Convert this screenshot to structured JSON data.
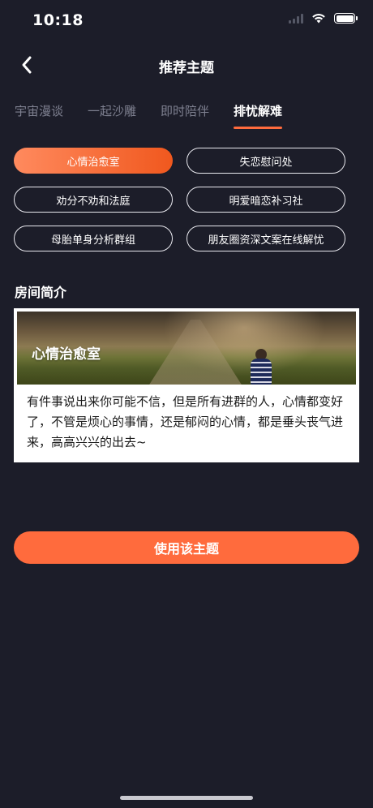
{
  "status_bar": {
    "time": "10:18"
  },
  "nav": {
    "title": "推荐主题",
    "back_icon": "chevron-left-icon"
  },
  "tabs": [
    {
      "label": "宇宙漫谈",
      "active": false
    },
    {
      "label": "一起沙雕",
      "active": false
    },
    {
      "label": "即时陪伴",
      "active": false
    },
    {
      "label": "排忧解难",
      "active": true
    }
  ],
  "topics": [
    {
      "label": "心情治愈室",
      "selected": true
    },
    {
      "label": "失恋慰问处",
      "selected": false
    },
    {
      "label": "劝分不劝和法庭",
      "selected": false
    },
    {
      "label": "明爱暗恋补习社",
      "selected": false
    },
    {
      "label": "母胎单身分析群组",
      "selected": false
    },
    {
      "label": "朋友圈资深文案在线解忧",
      "selected": false
    }
  ],
  "room": {
    "section_title": "房间简介",
    "banner_title": "心情治愈室",
    "description": "有件事说出来你可能不信，但是所有进群的人，心情都变好了，不管是烦心的事情，还是郁闷的心情，都是垂头丧气进来，高高兴兴的出去~"
  },
  "actions": {
    "use_topic_label": "使用该主题"
  },
  "colors": {
    "background": "#1c1d29",
    "accent": "#ff6b3d",
    "tab_inactive": "#7e8090"
  }
}
